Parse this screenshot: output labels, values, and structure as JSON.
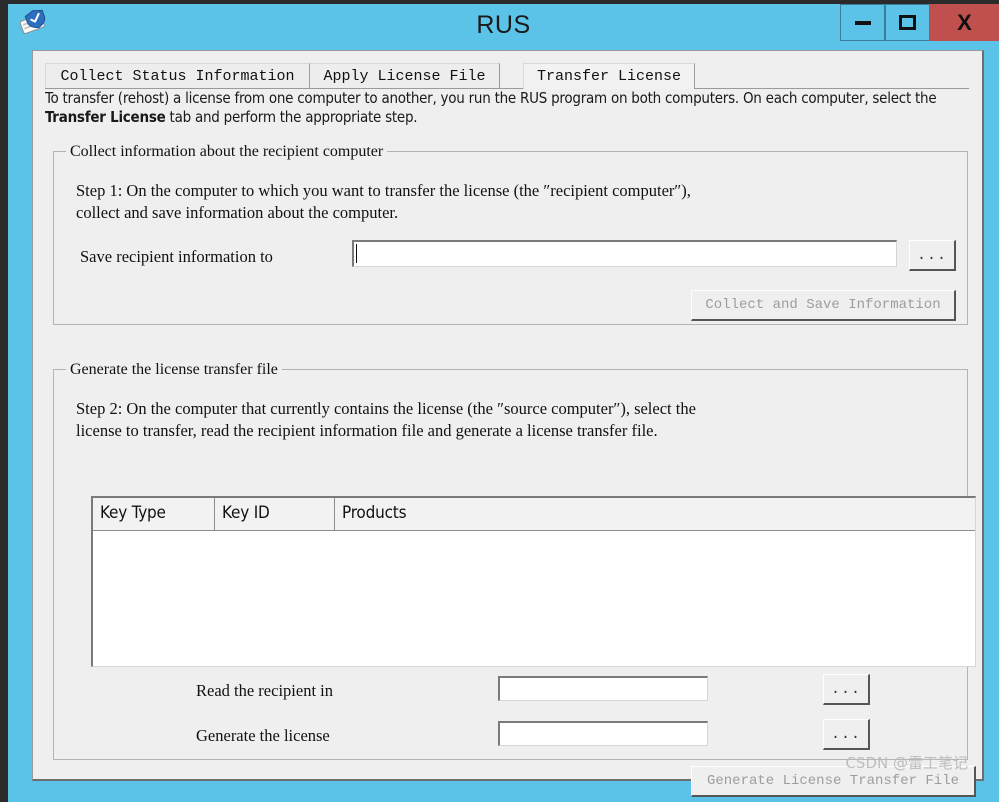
{
  "window": {
    "title": "RUS",
    "icon": "license-key-card-icon",
    "frame_color": "#5BC3E8",
    "client_color": "#EFEFEF",
    "controls": {
      "minimize": "minimize-icon",
      "maximize": "maximize-icon",
      "close": "X",
      "close_color": "#C0504D"
    }
  },
  "tabs": [
    {
      "label": "Collect Status Information",
      "active": false
    },
    {
      "label": "Apply License File",
      "active": false
    },
    {
      "label": "Transfer License",
      "active": true
    }
  ],
  "intro": {
    "part1": "To transfer (rehost) a license from one computer to another, you run the RUS program on both computers. On each computer, select the ",
    "bold": "Transfer License",
    "part2": " tab and perform the appropriate step."
  },
  "group1": {
    "title": "Collect information about the recipient computer",
    "step_text": "Step 1: On the computer to which you want to transfer the license (the ″recipient computer″),\ncollect and save information about the computer.",
    "save_label": "Save recipient information to",
    "save_value": "",
    "save_placeholder": "",
    "browse_label": "...",
    "action_label": "Collect and Save Information",
    "action_disabled": true
  },
  "group2": {
    "title": "Generate the license transfer file",
    "step_text": "Step 2: On the computer that currently contains the license (the ″source computer″), select the\nlicense to transfer, read the recipient information file and generate a license transfer file.",
    "grid": {
      "columns": [
        "Key Type",
        "Key ID",
        "Products"
      ],
      "rows": []
    },
    "read_label": "Read the recipient in",
    "read_value": "",
    "read_browse_label": "...",
    "generate_label": "Generate the license",
    "generate_value": "",
    "generate_browse_label": "...",
    "action_label": "Generate License Transfer File",
    "action_disabled": true
  },
  "watermark": "CSDN @雷工笔记"
}
